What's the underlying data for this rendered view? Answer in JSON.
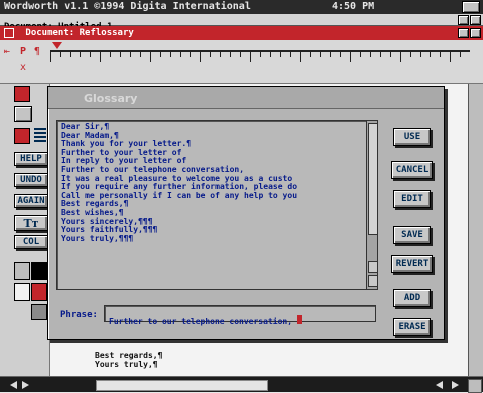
{
  "screen_title": "Wordworth v1.1 ©1994 Digita International",
  "clock": "4:50 PM",
  "document_1_title": "Document: Untitled 1",
  "document_2_title": "Document: Reflossary",
  "requester_title": "Glossary",
  "glossary_lines": [
    "Dear Sir,¶",
    "Dear Madam,¶",
    "Thank you for your letter.¶",
    "Further to your letter of",
    "In reply to your letter of",
    "Further to our telephone conversation,",
    "It was a real pleasure to welcome you as a custo",
    "If you require any further information, please do",
    "Call me personally if I can be of any help to you",
    "Best regards,¶",
    "Best wishes,¶",
    "Yours sincerely,¶¶¶",
    "Yours faithfully,¶¶¶",
    "Yours truly,¶¶¶"
  ],
  "buttons": {
    "use": "USE",
    "cancel": "CANCEL",
    "edit": "EDIT",
    "save": "SAVE",
    "revert": "REVERT",
    "add": "ADD",
    "erase": "ERASE"
  },
  "phrase_label": "Phrase:",
  "phrase_value": "Further to our telephone conversation, ",
  "side_tools": [
    "HELP",
    "UNDO",
    "AGAIN",
    "Tт",
    "COL"
  ],
  "doc_body_lines": [
    "Best regards,¶",
    "Yours truly,¶"
  ],
  "ruler_symbols": [
    "⇤",
    "P",
    "¶",
    "x"
  ],
  "colors": {
    "accent_red": "#c2252b",
    "text_blue": "#061a8a",
    "panel": "#b4b4b4"
  }
}
